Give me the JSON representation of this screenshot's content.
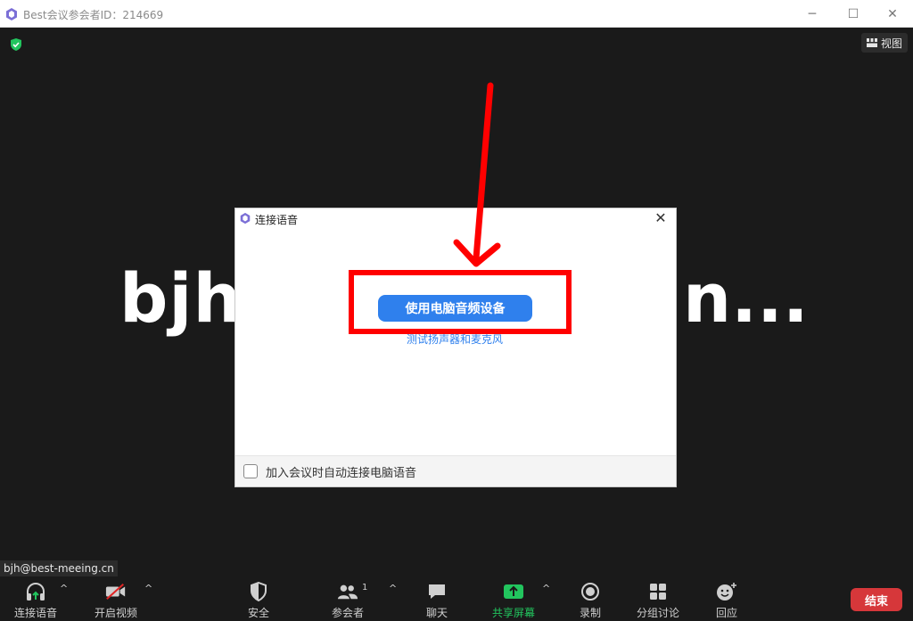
{
  "window": {
    "title": "Best会议参会者ID：214669",
    "view_label": "视图"
  },
  "meeting": {
    "participant_name_head": "bjh",
    "participant_name_tail": "n...",
    "user_label": "bjh@best-meeing.cn"
  },
  "dialog": {
    "title": "连接语音",
    "primary_button": "使用电脑音频设备",
    "test_link": "测试扬声器和麦克风",
    "auto_connect_label": "加入会议时自动连接电脑语音",
    "auto_connect_checked": false
  },
  "toolbar": {
    "audio": "连接语音",
    "video": "开启视频",
    "security": "安全",
    "participants": "参会者",
    "participants_count": "1",
    "chat": "聊天",
    "share": "共享屏幕",
    "record": "录制",
    "breakout": "分组讨论",
    "reactions": "回应",
    "end": "结束"
  },
  "colors": {
    "accent_blue": "#2f80ed",
    "annotation_red": "#ff0000",
    "end_red": "#d6373a",
    "share_green": "#22c55e",
    "background": "#1a1a1a"
  }
}
